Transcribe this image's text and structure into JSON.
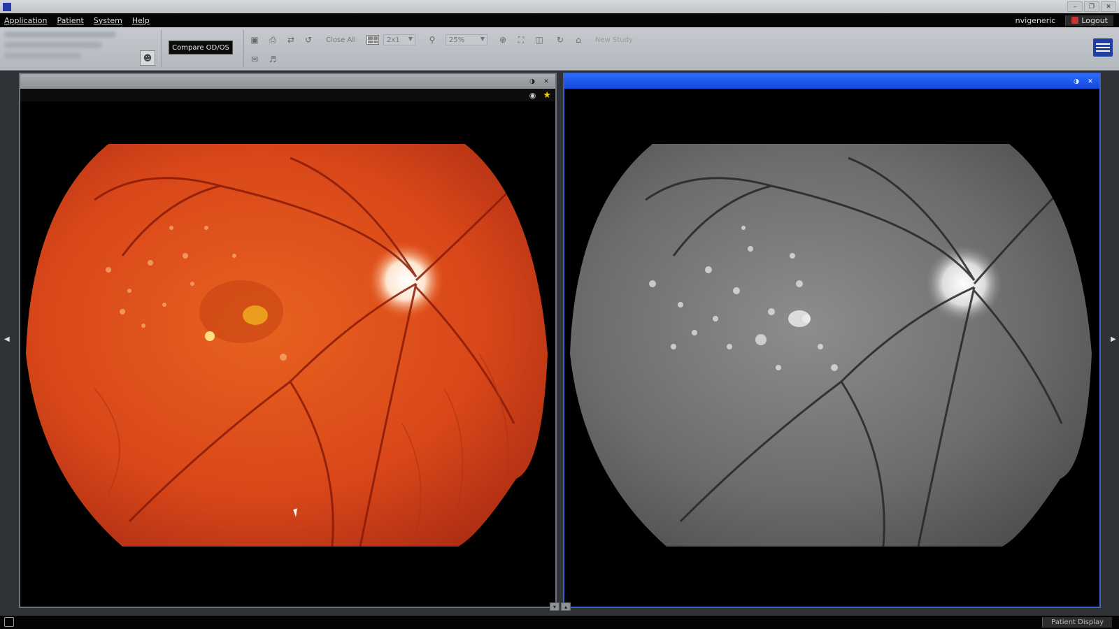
{
  "window": {
    "title": "",
    "buttons": [
      "–",
      "❐",
      "✕"
    ]
  },
  "menu": {
    "items": [
      "Application",
      "Patient",
      "System",
      "Help"
    ],
    "user": "nvigeneric",
    "logout": "Logout"
  },
  "toolbar": {
    "compare_label": "Compare OD/OS",
    "close_all_label": "Close All",
    "layout_value": "2x1",
    "zoom_value": "25%",
    "new_series_label": "New Study",
    "icons": [
      "save-icon",
      "print-icon",
      "export-icon",
      "delete-icon",
      "search-icon",
      "zoom-in-icon",
      "fit-icon",
      "rotate-icon",
      "undo-icon",
      "home-icon",
      "email-icon",
      "speaker-icon"
    ]
  },
  "viewers": {
    "left": {
      "header_icons": [
        "toggle-icon",
        "close-icon"
      ],
      "subbar_icons": [
        "eye-icon",
        "star-icon"
      ]
    },
    "right": {
      "header_icons": [
        "toggle-icon",
        "close-icon"
      ]
    }
  },
  "status": {
    "mode": "Patient Display"
  },
  "colors": {
    "active_header": "#1f5ef0",
    "accent_star": "#f4d000",
    "brand": "#1f3e9f"
  }
}
